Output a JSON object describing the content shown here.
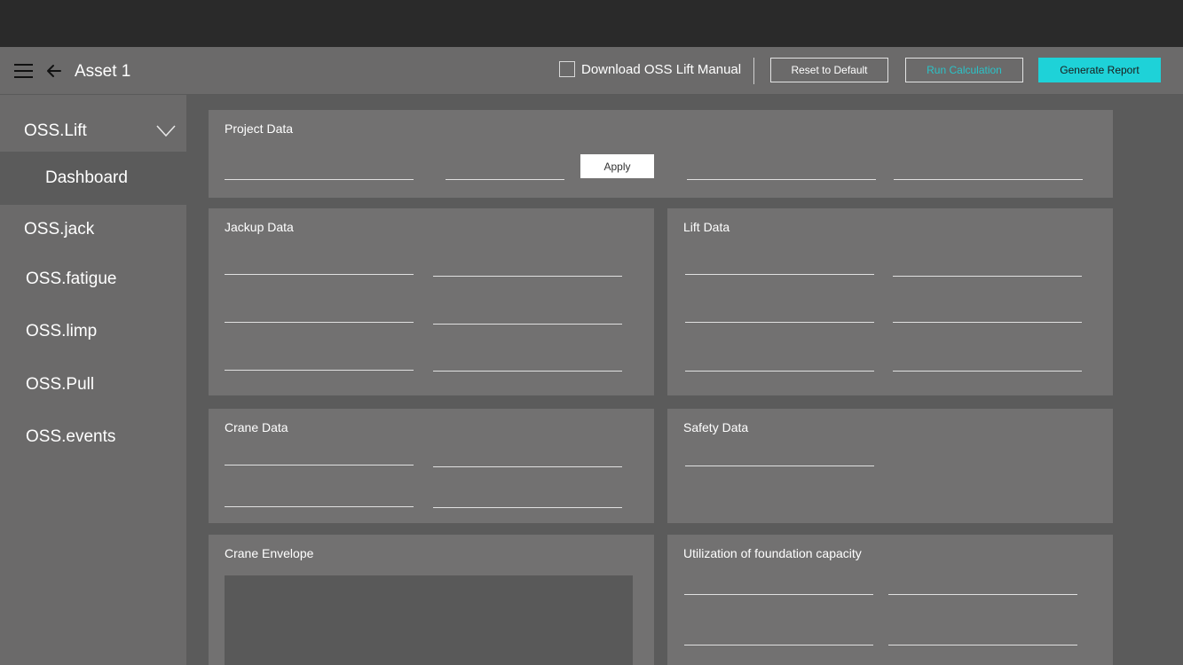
{
  "header": {
    "title": "Asset 1",
    "download_label": "Download OSS Lift Manual",
    "reset_label": "Reset to Default",
    "run_label": "Run Calculation",
    "generate_label": "Generate Report"
  },
  "sidebar": {
    "items": [
      {
        "label": "OSS.Lift"
      },
      {
        "label": "OSS.jack"
      },
      {
        "label": "OSS.fatigue"
      },
      {
        "label": "OSS.limp"
      },
      {
        "label": "OSS.Pull"
      },
      {
        "label": "OSS.events"
      }
    ],
    "sub_item": "Dashboard"
  },
  "panels": {
    "project": {
      "title": "Project Data",
      "apply_label": "Apply"
    },
    "jackup": {
      "title": "Jackup Data"
    },
    "lift": {
      "title": "Lift Data"
    },
    "crane": {
      "title": "Crane Data"
    },
    "safety": {
      "title": "Safety Data"
    },
    "envelope": {
      "title": "Crane Envelope"
    },
    "utilization": {
      "title": "Utilization of foundation capacity"
    }
  },
  "colors": {
    "accent": "#1ed2d8",
    "run_text": "#2bc3c8",
    "topbar": "#2a2a2a",
    "panel": "#727171",
    "background": "#5b5b5b"
  }
}
